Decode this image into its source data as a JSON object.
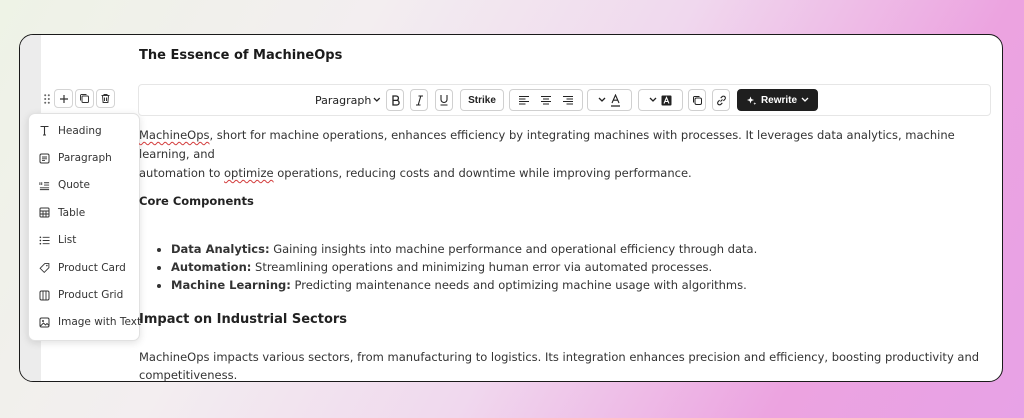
{
  "document": {
    "title": "The Essence of MachineOps",
    "intro_word": "MachineOps",
    "intro_rest_1": ", short for machine operations, enhances efficiency by integrating machines with processes. It leverages data analytics, machine learning, and",
    "intro_line2_pre": "automation to ",
    "intro_word2": "optimize",
    "intro_line2_post": " operations, reducing costs and downtime while improving performance.",
    "core_heading": "Core Components",
    "bullets": [
      {
        "term": "Data Analytics:",
        "text": " Gaining insights into machine performance and operational efficiency through data."
      },
      {
        "term": "Automation:",
        "text": " Streamlining operations and minimizing human error via automated processes."
      },
      {
        "term": "Machine Learning:",
        "text": " Predicting maintenance needs and optimizing machine usage with algorithms."
      }
    ],
    "impact_heading": "Impact on Industrial Sectors",
    "impact_text": "MachineOps impacts various sectors, from manufacturing to logistics. Its integration enhances precision and efficiency, boosting productivity and competitiveness."
  },
  "toolbar": {
    "paragraph_label": "Paragraph",
    "strike_label": "Strike",
    "rewrite_label": "Rewrite"
  },
  "block_menu": {
    "items": [
      {
        "label": "Heading",
        "icon": "heading-icon"
      },
      {
        "label": "Paragraph",
        "icon": "paragraph-icon"
      },
      {
        "label": "Quote",
        "icon": "quote-icon"
      },
      {
        "label": "Table",
        "icon": "table-icon"
      },
      {
        "label": "List",
        "icon": "list-icon"
      },
      {
        "label": "Product Card",
        "icon": "tag-icon"
      },
      {
        "label": "Product Grid",
        "icon": "grid-icon"
      },
      {
        "label": "Image with Text",
        "icon": "image-text-icon"
      }
    ]
  },
  "colors": {
    "rewrite_bg": "#1f1f1f",
    "spellcheck": "#d23b3b"
  }
}
